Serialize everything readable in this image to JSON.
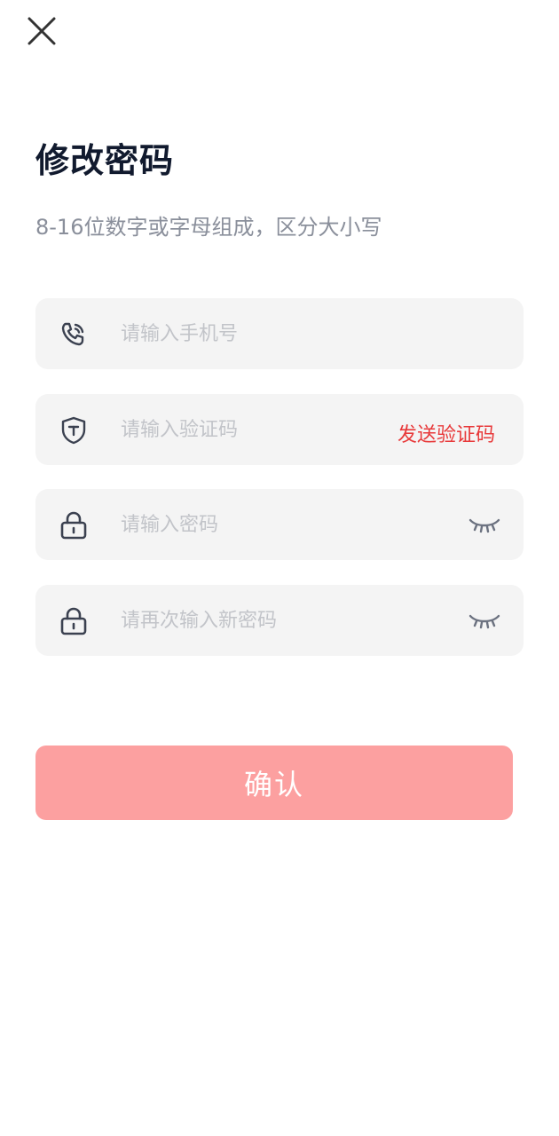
{
  "header": {
    "close_icon": "close-icon",
    "title": "修改密码",
    "subtitle": "8-16位数字或字母组成，区分大小写"
  },
  "form": {
    "phone": {
      "icon": "phone-icon",
      "placeholder": "请输入手机号",
      "value": ""
    },
    "code": {
      "icon": "shield-icon",
      "placeholder": "请输入验证码",
      "value": "",
      "send_label": "发送验证码"
    },
    "password": {
      "icon": "lock-icon",
      "placeholder": "请输入密码",
      "value": "",
      "toggle_icon": "eye-closed-icon"
    },
    "confirm_password": {
      "icon": "lock-icon",
      "placeholder": "请再次输入新密码",
      "value": "",
      "toggle_icon": "eye-closed-icon"
    }
  },
  "submit": {
    "label": "确认"
  },
  "colors": {
    "title": "#111a2e",
    "subtitle": "#8a8f9b",
    "field_bg": "#f4f4f4",
    "placeholder": "#c2c4c9",
    "send_code": "#e8393a",
    "button_bg": "#fca0a0",
    "icon": "#3b4150"
  }
}
